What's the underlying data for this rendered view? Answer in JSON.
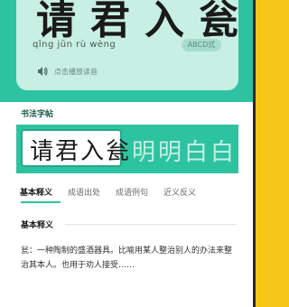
{
  "idiom": {
    "title": "请君入瓮",
    "pinyin": "qǐng jūn rù wèng",
    "badge": "ABCD式",
    "audio_label": "点击播放读音"
  },
  "calligraphy": {
    "section_label": "书法字帖",
    "section_sub": "",
    "style_1": "请君入瓮",
    "style_2": "明明白白"
  },
  "tabs": [
    {
      "label": "基本释义",
      "active": true
    },
    {
      "label": "成语出处",
      "active": false
    },
    {
      "label": "成语例句",
      "active": false
    },
    {
      "label": "近义反义",
      "active": false
    }
  ],
  "definition": {
    "heading": "基本释义",
    "body": "瓮：一种陶制的盛酒器具。比喻用某人整治别人的办法来整治其本人。也用于劝人接受……"
  },
  "colors": {
    "accent": "#2ec3a0",
    "hero_bg": "#c8efe3",
    "frame": "#f5c518"
  }
}
